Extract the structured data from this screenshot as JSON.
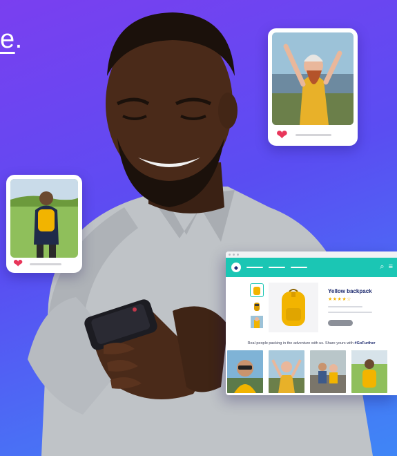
{
  "headline": {
    "fragment": "e",
    "trailing": "."
  },
  "cards": {
    "top": {
      "photo": "woman-cheering-mountains-photo",
      "heart": "heart-icon"
    },
    "left": {
      "photo": "hiker-yellow-backpack-photo",
      "heart": "heart-icon"
    }
  },
  "store": {
    "product_title": "Yellow backpack",
    "rating_stars": "★★★★☆",
    "ugc_caption": "Real people packing in the adventure with us. Share yours with",
    "ugc_hashtag": "#GoFurther"
  },
  "colors": {
    "navbar": "#1bc6b4",
    "heart": "#e8365a",
    "backpack": "#f2b400",
    "title": "#1d2a6e"
  }
}
